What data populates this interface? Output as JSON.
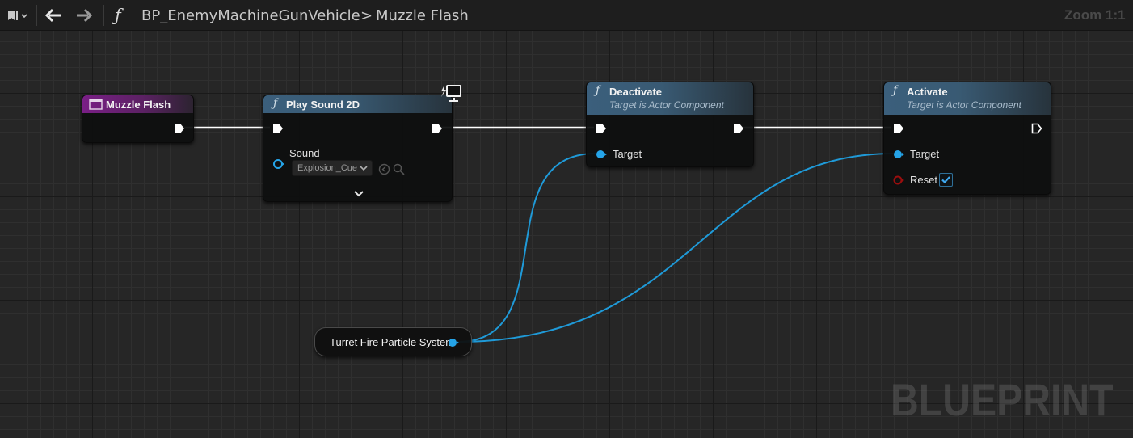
{
  "toolbar": {
    "bookmark_icon": "bookmark-icon",
    "back_icon": "arrow-left-icon",
    "forward_icon": "arrow-right-icon",
    "function_glyph": "ƒ",
    "breadcrumb_blueprint": "BP_EnemyMachineGunVehicle",
    "breadcrumb_separator": ">",
    "breadcrumb_function": "Muzzle Flash",
    "zoom": "Zoom 1:1"
  },
  "nodes": {
    "entry": {
      "title": "Muzzle Flash",
      "color": "#7a1f86"
    },
    "play_sound": {
      "title": "Play Sound 2D",
      "pin_sound_label": "Sound",
      "sound_value": "Explosion_Cue",
      "icon": "monitor-lightning-icon"
    },
    "deactivate": {
      "title": "Deactivate",
      "subtitle": "Target is Actor Component",
      "pin_target_label": "Target"
    },
    "activate": {
      "title": "Activate",
      "subtitle": "Target is Actor Component",
      "pin_target_label": "Target",
      "pin_reset_label": "Reset",
      "reset_checked": true
    },
    "variable": {
      "label": "Turret Fire Particle System"
    }
  },
  "colors": {
    "object_pin": "#25a4e8",
    "bool_pin": "#9b0e0e",
    "exec_wire": "#ffffff"
  },
  "watermark": "BLUEPRINT"
}
